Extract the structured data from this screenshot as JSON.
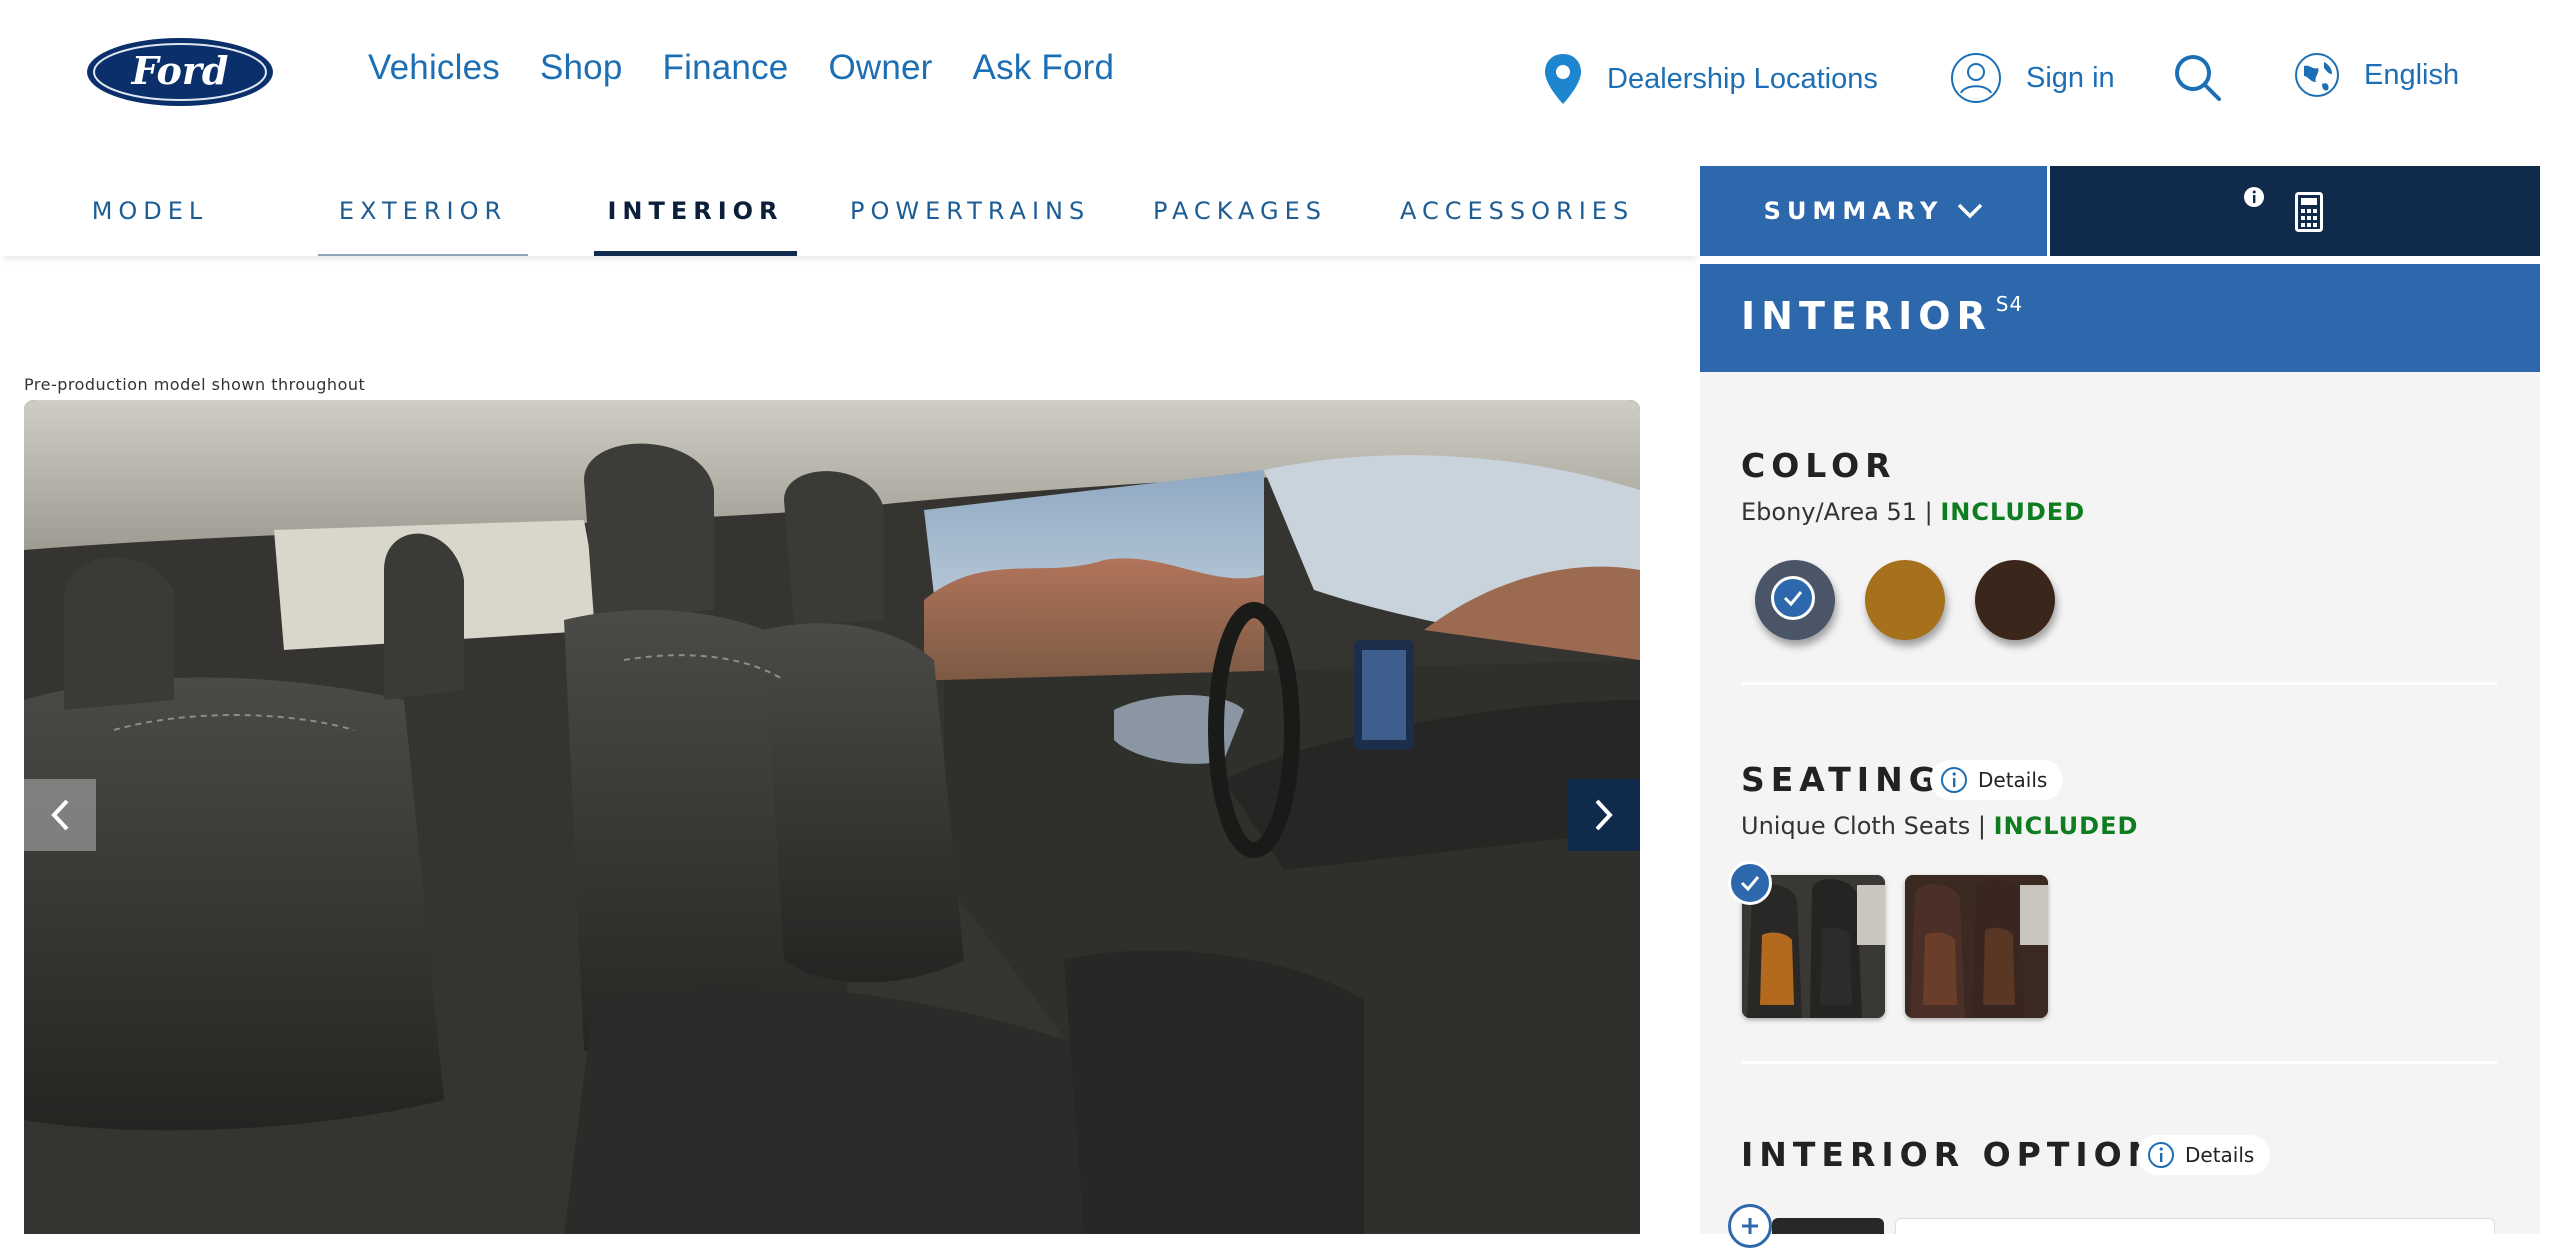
{
  "brand": {
    "logo_text": "Ford"
  },
  "main_nav": [
    "Vehicles",
    "Shop",
    "Finance",
    "Owner",
    "Ask Ford"
  ],
  "utility": {
    "dealer": "Dealership Locations",
    "sign_in": "Sign in",
    "language": "English"
  },
  "sub_nav": {
    "tabs": [
      "MODEL",
      "EXTERIOR",
      "INTERIOR",
      "POWERTRAINS",
      "PACKAGES",
      "ACCESSORIES"
    ],
    "active": "INTERIOR",
    "summary_label": "SUMMARY"
  },
  "viewer": {
    "disclaimer": "Pre-production model shown throughout"
  },
  "panel": {
    "title": "INTERIOR",
    "title_sup": "S4",
    "color": {
      "title": "COLOR",
      "selected_name": "Ebony/Area 51 | ",
      "status": "INCLUDED",
      "swatches": [
        {
          "color": "#4a5668",
          "selected": true
        },
        {
          "color": "#a6701c",
          "selected": false
        },
        {
          "color": "#3a261a",
          "selected": false
        }
      ]
    },
    "seating": {
      "title": "SEATING",
      "details": "Details",
      "selected_name": "Unique Cloth Seats | ",
      "status": "INCLUDED"
    },
    "interior_options": {
      "title": "INTERIOR OPTIONS",
      "details": "Details"
    }
  },
  "colors": {
    "link_blue": "#1d6fb5",
    "panel_blue": "#2d68ad",
    "navy": "#102a4c",
    "included_green": "#0d7d1f"
  }
}
